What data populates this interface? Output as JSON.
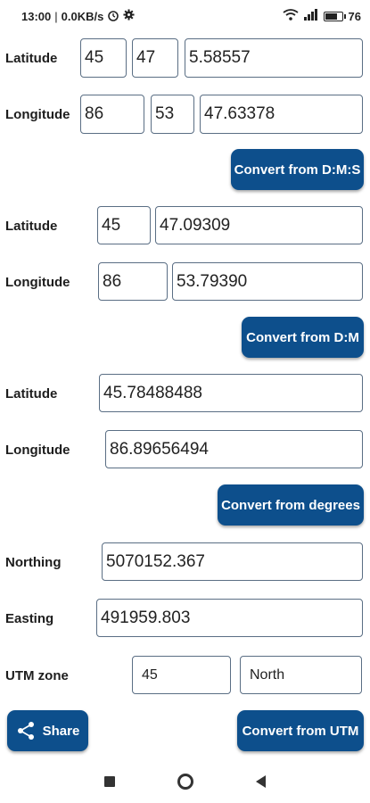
{
  "status_bar": {
    "time": "13:00",
    "network_speed": "0.0KB/s",
    "battery_percent": "76",
    "battery_level": 0.76,
    "icons": [
      "alarm-icon",
      "gear-icon",
      "wifi-icon",
      "signal-icon",
      "battery-icon"
    ]
  },
  "dms": {
    "lat_label": "Latitude",
    "lat_deg": "45",
    "lat_min": "47",
    "lat_sec": "5.58557",
    "lon_label": "Longitude",
    "lon_deg": "86",
    "lon_min": "53",
    "lon_sec": "47.63378",
    "button": "Convert from D:M:S"
  },
  "dm": {
    "lat_label": "Latitude",
    "lat_deg": "45",
    "lat_min": "47.09309",
    "lon_label": "Longitude",
    "lon_deg": "86",
    "lon_min": "53.79390",
    "button": "Convert from D:M"
  },
  "degrees": {
    "lat_label": "Latitude",
    "lat_val": "45.78488488",
    "lon_label": "Longitude",
    "lon_val": "86.89656494",
    "button": "Convert from degrees"
  },
  "utm": {
    "northing_label": "Northing",
    "northing_val": "5070152.367",
    "easting_label": "Easting",
    "easting_val": "491959.803",
    "zone_label": "UTM zone",
    "zone_val": "45",
    "hemisphere_val": "North",
    "button": "Convert from UTM"
  },
  "share": {
    "label": "Share"
  },
  "colors": {
    "button_blue": "#0d4f8c",
    "field_border": "#5a6e84"
  }
}
